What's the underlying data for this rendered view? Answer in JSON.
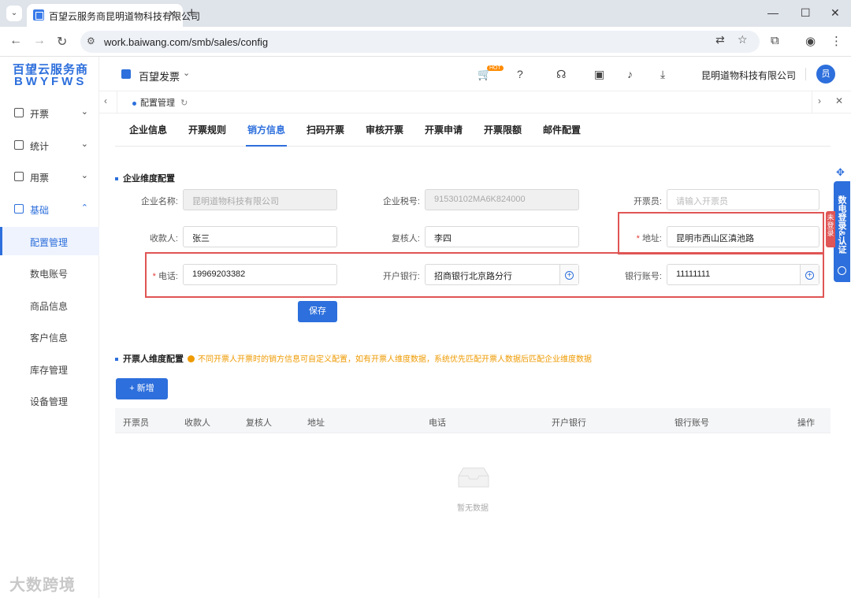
{
  "browser": {
    "tab_title": "百望云服务商昆明道物科技有限公司",
    "tab_close": "✕",
    "new_tab": "+",
    "url": "work.baiwang.com/smb/sales/config",
    "win_min": "—",
    "win_max": "☐",
    "win_close": "✕"
  },
  "brand": {
    "line1": "百望云服务商",
    "line2": "BWYFWS"
  },
  "sidebar": {
    "items": [
      {
        "label": "开票"
      },
      {
        "label": "统计"
      },
      {
        "label": "用票"
      },
      {
        "label": "基础"
      }
    ],
    "sub_items": [
      {
        "label": "配置管理"
      },
      {
        "label": "数电账号"
      },
      {
        "label": "商品信息"
      },
      {
        "label": "客户信息"
      },
      {
        "label": "库存管理"
      },
      {
        "label": "设备管理"
      }
    ]
  },
  "header": {
    "product": "百望发票",
    "hot": "HOT",
    "company": "昆明道物科技有限公司",
    "avatar": "员"
  },
  "page_tab": {
    "label": "配置管理"
  },
  "tabs": [
    "企业信息",
    "开票规则",
    "销方信息",
    "扫码开票",
    "审核开票",
    "开票申请",
    "开票限额",
    "邮件配置"
  ],
  "section1": {
    "title": "企业维度配置",
    "fields": {
      "company_name": {
        "label": "企业名称:",
        "value": "昆明道物科技有限公司"
      },
      "tax_no": {
        "label": "企业税号:",
        "value": "91530102MA6K824000"
      },
      "issuer": {
        "label": "开票员:",
        "placeholder": "请输入开票员"
      },
      "payee": {
        "label": "收款人:",
        "value": "张三"
      },
      "reviewer": {
        "label": "复核人:",
        "value": "李四"
      },
      "address": {
        "label": "地址:",
        "value": "昆明市西山区滇池路"
      },
      "phone": {
        "label": "电话:",
        "value": "19969203382"
      },
      "bank": {
        "label": "开户银行:",
        "value": "招商银行北京路分行"
      },
      "account": {
        "label": "银行账号:",
        "value": "11111111"
      }
    },
    "save": "保存"
  },
  "section2": {
    "title": "开票人维度配置",
    "notice": "不同开票人开票时的销方信息可自定义配置，如有开票人维度数据，系统优先匹配开票人数据后匹配企业维度数据",
    "add": "+ 新增",
    "columns": [
      "开票员",
      "收款人",
      "复核人",
      "地址",
      "电话",
      "开户银行",
      "银行账号",
      "操作"
    ],
    "empty": "暂无数据"
  },
  "float": {
    "text": "数电登录&认证",
    "tag": "未登录"
  },
  "watermark": "大数跨境"
}
